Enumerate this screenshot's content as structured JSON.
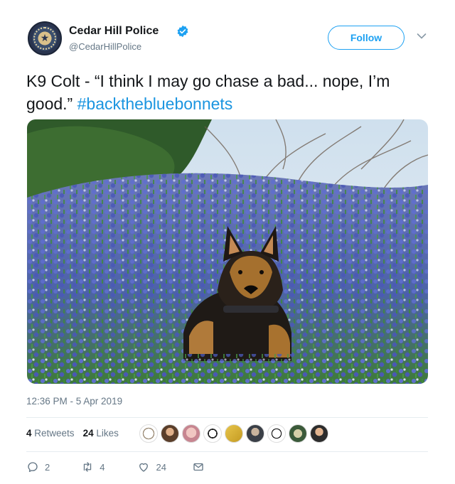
{
  "account": {
    "display_name": "Cedar Hill Police",
    "handle": "@CedarHillPolice",
    "verified": true,
    "follow_label": "Follow"
  },
  "tweet": {
    "text_line": "K9 Colt -  “I think I may go chase a bad... nope, I’m good.” ",
    "hashtag": "#backthebluebonnets",
    "timestamp": "12:36 PM - 5 Apr 2019"
  },
  "stats": {
    "retweets_count": "4",
    "retweets_label": "Retweets",
    "likes_count": "24",
    "likes_label": "Likes"
  },
  "actions": {
    "reply_count": "2",
    "retweet_count": "4",
    "like_count": "24"
  },
  "colors": {
    "accent": "#1da1f2",
    "hashtag": "#1b95e0",
    "muted": "#657786"
  },
  "icons": [
    "verified-badge-icon",
    "chevron-down-icon",
    "reply-icon",
    "retweet-icon",
    "heart-icon",
    "direct-message-icon"
  ]
}
